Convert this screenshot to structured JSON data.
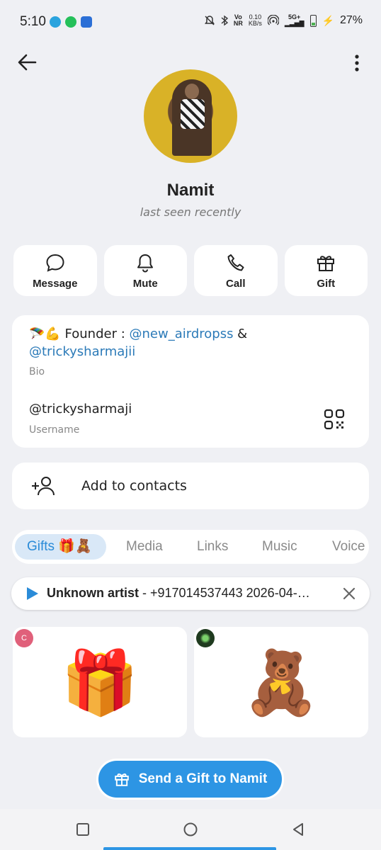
{
  "status_bar": {
    "time": "5:10",
    "network_top": "Vo",
    "network_bottom": "NR",
    "speed_top": "0.10",
    "speed_bottom": "KB/s",
    "cell": "5G+",
    "battery": "27%"
  },
  "profile": {
    "name": "Namit",
    "status": "last seen recently"
  },
  "actions": [
    {
      "label": "Message",
      "icon": "message-icon"
    },
    {
      "label": "Mute",
      "icon": "bell-icon"
    },
    {
      "label": "Call",
      "icon": "phone-icon"
    },
    {
      "label": "Gift",
      "icon": "gift-icon"
    }
  ],
  "info": {
    "bio_prefix": "🪂💪 Founder : ",
    "bio_link1": "@new_airdropss",
    "bio_amp": " &",
    "bio_link2": "@trickysharmajii",
    "bio_label": "Bio",
    "username": "@trickysharmaji",
    "username_label": "Username"
  },
  "contacts": {
    "add_label": "Add to contacts"
  },
  "tabs": [
    {
      "label": "Gifts 🎁🧸",
      "active": true
    },
    {
      "label": "Media"
    },
    {
      "label": "Links"
    },
    {
      "label": "Music"
    },
    {
      "label": "Voice"
    }
  ],
  "player": {
    "artist": "Unknown artist",
    "track": " - +917014537443 2026-04-…"
  },
  "gifts": [
    {
      "emoji": "🎁",
      "sender_initial": "C",
      "sender_color": "#e0607a"
    },
    {
      "emoji": "🧸",
      "sender_initial": "",
      "sender_color": "#1f3a1f"
    }
  ],
  "send_gift": {
    "label": "Send a Gift to Namit"
  },
  "colors": {
    "accent": "#2d95e4",
    "link": "#2b7ab8",
    "background": "#eff0f4"
  }
}
